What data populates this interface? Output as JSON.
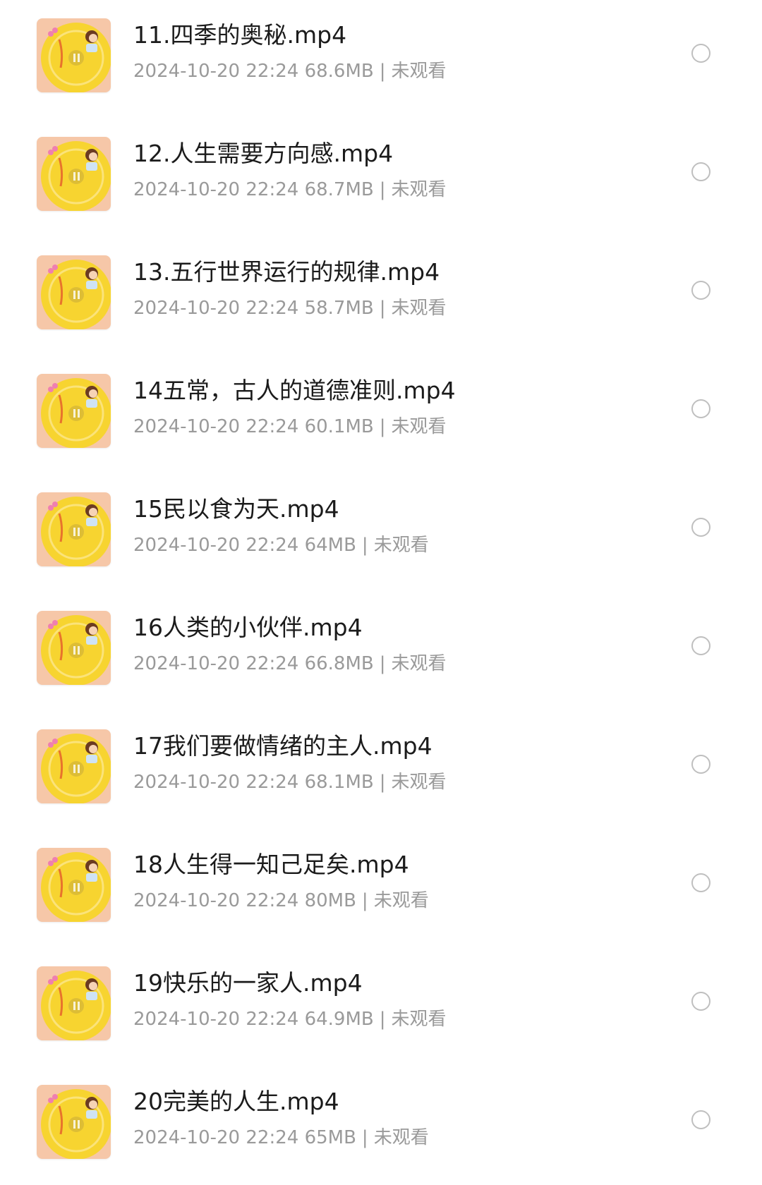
{
  "files": [
    {
      "title": "11.四季的奥秘.mp4",
      "date": "2024-10-20 22:24",
      "size": "68.6MB",
      "status": "未观看",
      "thumb_icon": "video-thumbnail-icon"
    },
    {
      "title": "12.人生需要方向感.mp4",
      "date": "2024-10-20 22:24",
      "size": "68.7MB",
      "status": "未观看",
      "thumb_icon": "video-thumbnail-icon"
    },
    {
      "title": "13.五行世界运行的规律.mp4",
      "date": "2024-10-20 22:24",
      "size": "58.7MB",
      "status": "未观看",
      "thumb_icon": "video-thumbnail-icon"
    },
    {
      "title": "14五常，古人的道德准则.mp4",
      "date": "2024-10-20 22:24",
      "size": "60.1MB",
      "status": "未观看",
      "thumb_icon": "video-thumbnail-icon"
    },
    {
      "title": "15民以食为天.mp4",
      "date": "2024-10-20 22:24",
      "size": "64MB",
      "status": "未观看",
      "thumb_icon": "video-thumbnail-icon"
    },
    {
      "title": "16人类的小伙伴.mp4",
      "date": "2024-10-20 22:24",
      "size": "66.8MB",
      "status": "未观看",
      "thumb_icon": "video-thumbnail-icon"
    },
    {
      "title": "17我们要做情绪的主人.mp4",
      "date": "2024-10-20 22:24",
      "size": "68.1MB",
      "status": "未观看",
      "thumb_icon": "video-thumbnail-icon"
    },
    {
      "title": "18人生得一知己足矣.mp4",
      "date": "2024-10-20 22:24",
      "size": "80MB",
      "status": "未观看",
      "thumb_icon": "video-thumbnail-icon"
    },
    {
      "title": "19快乐的一家人.mp4",
      "date": "2024-10-20 22:24",
      "size": "64.9MB",
      "status": "未观看",
      "thumb_icon": "video-thumbnail-icon"
    },
    {
      "title": "20完美的人生.mp4",
      "date": "2024-10-20 22:24",
      "size": "65MB",
      "status": "未观看",
      "thumb_icon": "video-thumbnail-icon"
    }
  ],
  "meta_separator": "|",
  "colors": {
    "title": "#1b1b1b",
    "meta": "#9a9a9a",
    "thumb_background": "#f6c7a8",
    "thumb_disc": "#f7d430",
    "radio_border": "#bfbfbf"
  }
}
